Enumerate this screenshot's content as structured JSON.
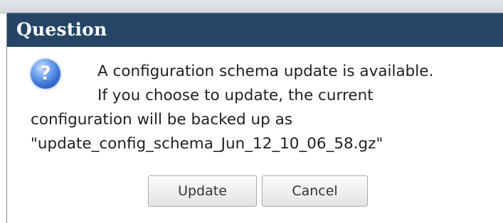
{
  "dialog": {
    "title": "Question",
    "icon": "question-icon",
    "icon_glyph": "?",
    "message_lines": [
      "A configuration schema update is available.",
      "If you choose to update, the current",
      "configuration will be backed up as",
      "\"update_config_schema_Jun_12_10_06_58.gz\""
    ],
    "buttons": {
      "update_label": "Update",
      "cancel_label": "Cancel"
    }
  },
  "colors": {
    "title_bar": "#244565",
    "title_text": "#ffffff",
    "icon_blue": "#3a72d6"
  }
}
